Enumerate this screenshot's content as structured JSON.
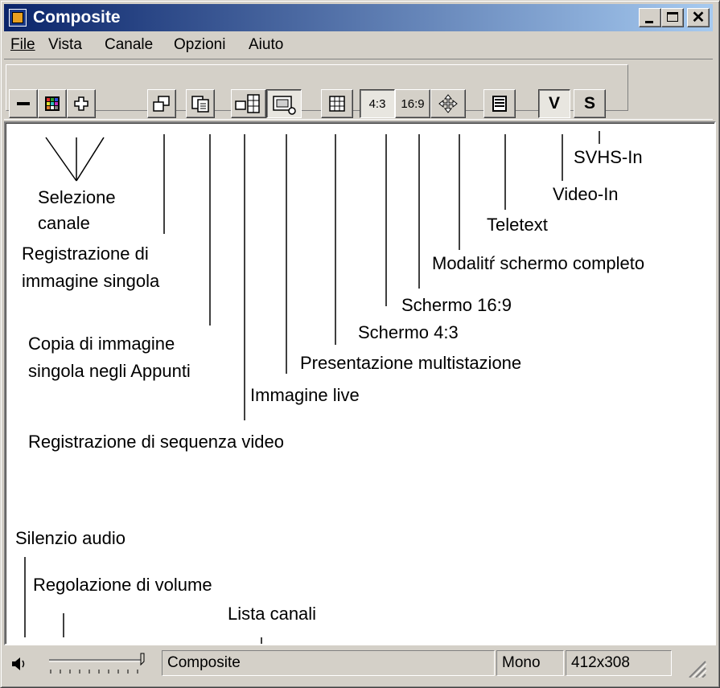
{
  "window": {
    "title": "Composite"
  },
  "menu": [
    {
      "label": "File"
    },
    {
      "label": "Vista"
    },
    {
      "label": "Canale"
    },
    {
      "label": "Opzioni"
    },
    {
      "label": "Aiuto"
    }
  ],
  "toolbar": {
    "btn_43": "4:3",
    "btn_169": "16:9",
    "btn_v": "V",
    "btn_s": "S"
  },
  "annotations": {
    "selezione_canale_1": "Selezione",
    "selezione_canale_2": "canale",
    "reg_img_1": "Registrazione di",
    "reg_img_2": "immagine singola",
    "copia_1": "Copia di immagine",
    "copia_2": "singola negli Appunti",
    "immagine_live": "Immagine live",
    "reg_seq": "Registrazione di sequenza video",
    "presentazione": "Presentazione multistazione",
    "schermo43": "Schermo 4:3",
    "schermo169": "Schermo 16:9",
    "modalita": "Modalitŕ schermo completo",
    "teletext": "Teletext",
    "video_in": "Video-In",
    "svhs_in": "SVHS-In",
    "silenzio": "Silenzio audio",
    "volume": "Regolazione di volume",
    "lista": "Lista canali"
  },
  "status": {
    "channel": "Composite",
    "audio": "Mono",
    "resolution": "412x308"
  }
}
